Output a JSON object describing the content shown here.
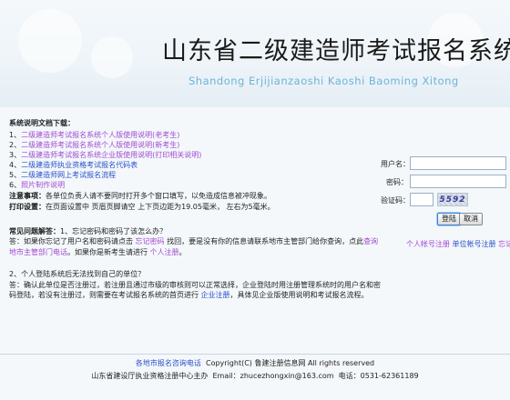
{
  "header": {
    "title_cn": "山东省二级建造师考试报名系统",
    "title_en": "Shandong Erjijianzaoshi Kaoshi Baoming Xitong"
  },
  "docs": {
    "heading": "系统说明文档下载：",
    "items": [
      {
        "num": "1、",
        "label": "二级建造师考试报名系统个人版使用说明(老考生)",
        "color": "#a24ad0"
      },
      {
        "num": "2、",
        "label": "二级建造师考试报名系统个人版使用说明(新考生)",
        "color": "#a24ad0"
      },
      {
        "num": "3、",
        "label": "二级建造师考试报名系统企业版使用说明(打印相关说明)",
        "color": "#a24ad0"
      },
      {
        "num": "4、",
        "label": "二级建造师执业资格考试报名代码表",
        "color": "#2850c8"
      },
      {
        "num": "5、",
        "label": "二级建造师网上考试报名流程",
        "color": "#2850c8"
      },
      {
        "num": "6、",
        "label": "照片制作说明",
        "color": "#a24ad0"
      }
    ]
  },
  "notes": {
    "note_label": "注意事项：",
    "note_text": "各单位负责人请不要同时打开多个窗口填写，以免造成信息被冲现象。",
    "print_label": "打印设置：",
    "print_text": "在页面设置中 页眉页脚请空 上下页边距为19.05毫米， 左右为5毫米。"
  },
  "faq": {
    "heading": "常见问题解答：",
    "q1": "1、忘记密码和密码了该怎么办？",
    "a1_prefix": "答：如果你忘记了用户名和密码请点击 ",
    "a1_link1": "忘记密码",
    "a1_mid": " 找回，要是没有你的信息请联系地市主管部门给你查询，点此",
    "a1_link2": "查询地市主管部门电话",
    "a1_mid2": "。如果你是新考生请进行 ",
    "a1_link3": "个人注册",
    "a1_end": "。",
    "q2": "2、个人登陆系统后无法找到自己的单位？",
    "a2_prefix": "答：确认此单位是否注册过，若注册且通过市级的审核则可以正常选择，企业登陆时用注册管理系统时的用户名和密码登陆，若没有注册过，则需要在考试报名系统的首页进行 ",
    "a2_link": "企业注册",
    "a2_end": "，具体见企业版使用说明和考试报名流程。"
  },
  "login": {
    "username_label": "用户名：",
    "username_value": "",
    "password_label": "密码：",
    "password_value": "",
    "captcha_label": "验证码：",
    "captcha_value": "",
    "captcha_image_text": "5592",
    "login_button": "登陆",
    "cancel_button": "取消"
  },
  "register_links": {
    "personal": "个人帐号注册",
    "unit": "单位帐号注册",
    "forgot": "忘记密码"
  },
  "footer": {
    "phone_link": "各地市报名咨询电话",
    "copyright": "Copyright(C) 鲁建注册信息网 All rights reserved",
    "host_line": "山东省建设厅执业资格注册中心主办",
    "email_line": "Email：zhucezhongxin@163.com",
    "tel_line": "电话：0531-62361189"
  },
  "colors": {
    "link_purple": "#a24ad0",
    "link_blue": "#2850c8",
    "title_en": "#6cb4d8",
    "background": "#f4f8fb"
  }
}
